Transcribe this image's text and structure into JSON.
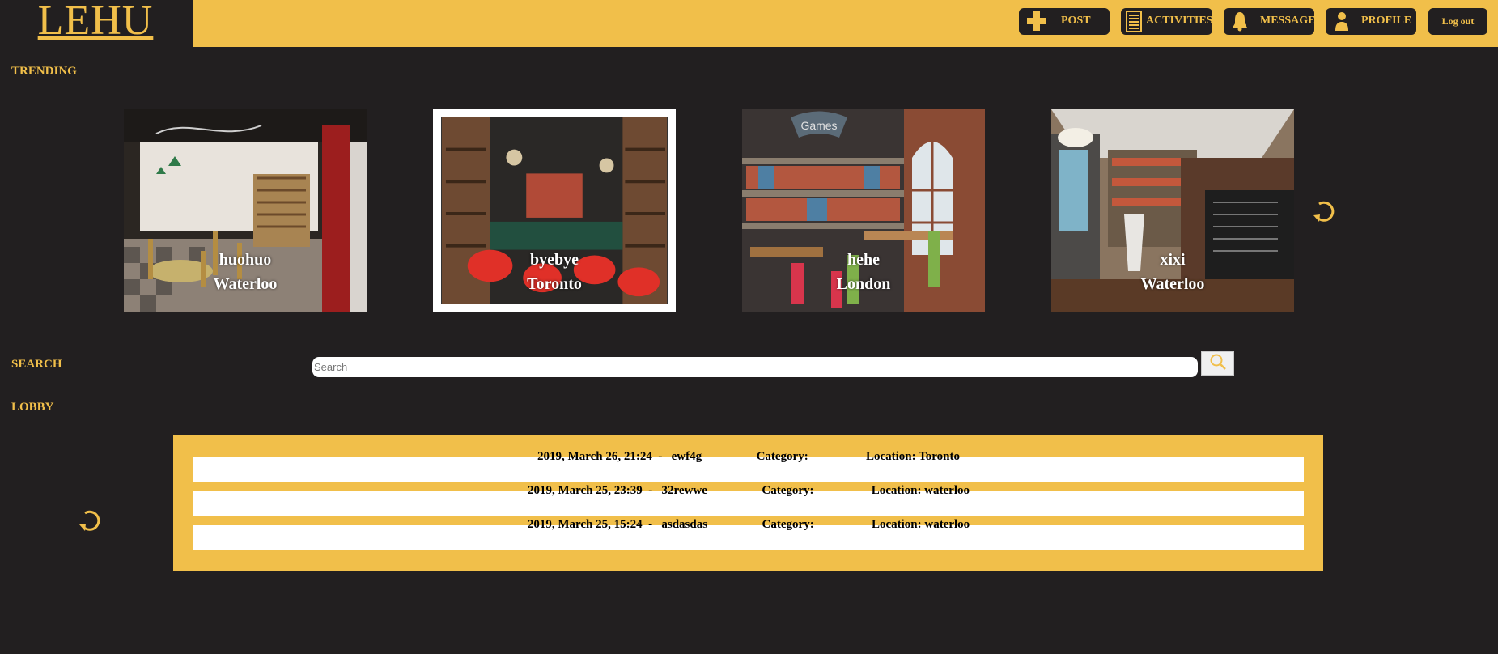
{
  "app": {
    "logo": "LEHU"
  },
  "nav": {
    "post": "POST",
    "activities": "ACTIVITIES",
    "message": "MESSAGE",
    "profile": "PROFILE",
    "logout": "Log out"
  },
  "sections": {
    "trending": "TRENDING",
    "search": "SEARCH",
    "lobby": "LOBBY"
  },
  "trending": [
    {
      "name": "huohuo",
      "city": "Waterloo"
    },
    {
      "name": "byebye",
      "city": "Toronto"
    },
    {
      "name": "hehe",
      "city": "London"
    },
    {
      "name": "xixi",
      "city": "Waterloo"
    }
  ],
  "search": {
    "placeholder": "Search",
    "value": ""
  },
  "lobby": [
    {
      "text": "2019, March 26, 21:24  -   ewf4g                  Category:                   Location: Toronto"
    },
    {
      "text": "2019, March 25, 23:39  -   32rewwe                  Category:                   Location: waterloo"
    },
    {
      "text": "2019, March 25, 15:24  -   asdasdas                  Category:                   Location: waterloo"
    }
  ],
  "colors": {
    "accent": "#f1bf4a",
    "background": "#221f20",
    "row": "#ffffff"
  },
  "icons": {
    "post": "plus-icon",
    "activities": "list-icon",
    "message": "bell-icon",
    "profile": "person-icon",
    "refresh": "refresh-icon",
    "search": "magnifier-icon"
  }
}
